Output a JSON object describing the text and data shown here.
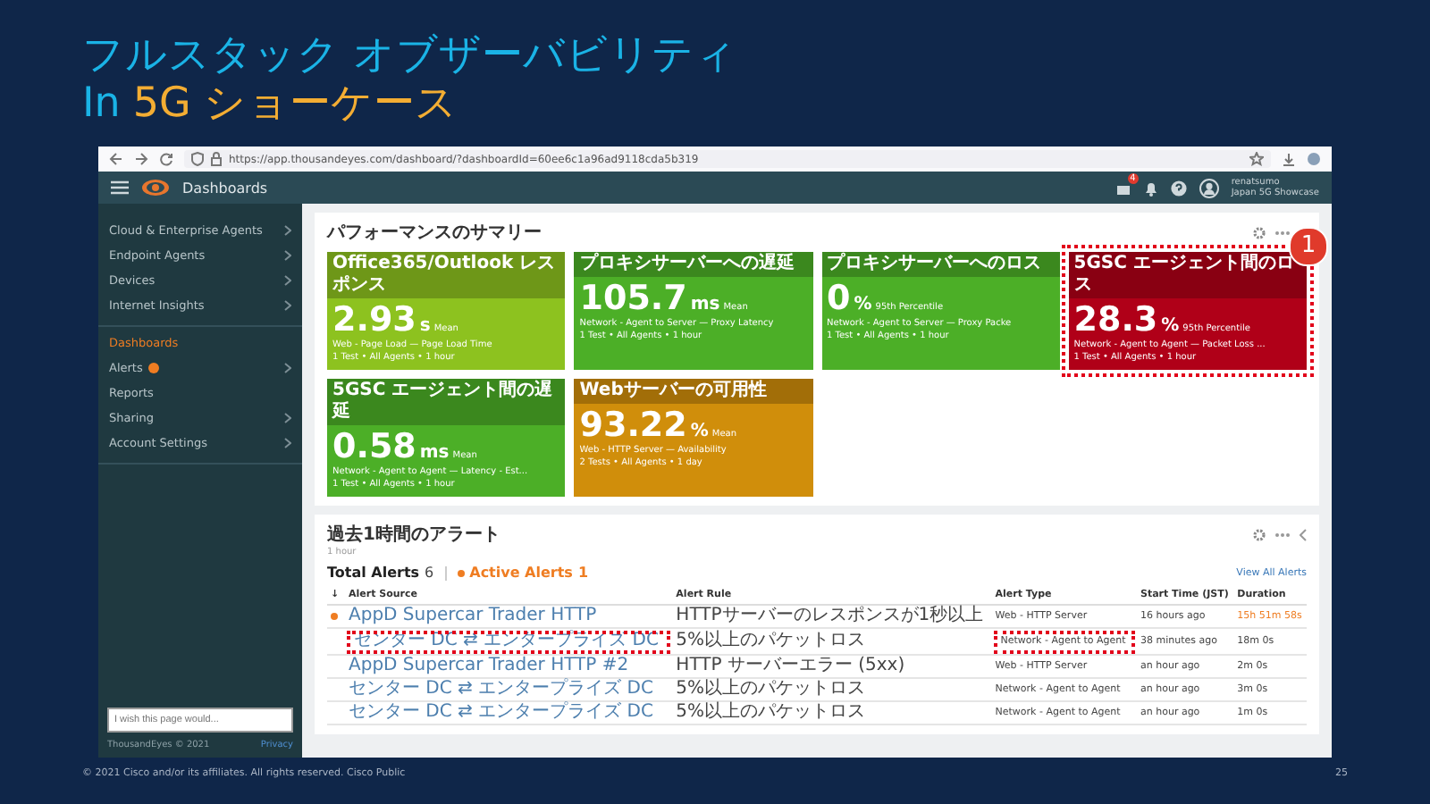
{
  "slide": {
    "title": "フルスタック オブザーバビリティ",
    "subtitle_lead": "In",
    "subtitle": "5G ショーケース"
  },
  "browser": {
    "url": "https://app.thousandeyes.com/dashboard/?dashboardId=60ee6c1a96ad9118cda5b319"
  },
  "app_header": {
    "title": "Dashboards",
    "notification_count": "4",
    "user_name": "renatsumo",
    "account": "Japan 5G Showcase"
  },
  "sidebar": {
    "sections": [
      [
        {
          "label": "Cloud & Enterprise Agents",
          "selected": false,
          "expandable": true,
          "badge": false
        },
        {
          "label": "Endpoint Agents",
          "selected": false,
          "expandable": true,
          "badge": false
        },
        {
          "label": "Devices",
          "selected": false,
          "expandable": true,
          "badge": false
        },
        {
          "label": "Internet Insights",
          "selected": false,
          "expandable": true,
          "badge": false
        }
      ],
      [
        {
          "label": "Dashboards",
          "selected": true,
          "expandable": false,
          "badge": false
        },
        {
          "label": "Alerts",
          "selected": false,
          "expandable": true,
          "badge": true
        },
        {
          "label": "Reports",
          "selected": false,
          "expandable": false,
          "badge": false
        },
        {
          "label": "Sharing",
          "selected": false,
          "expandable": true,
          "badge": false
        },
        {
          "label": "Account Settings",
          "selected": false,
          "expandable": true,
          "badge": false
        }
      ]
    ],
    "feedback_placeholder": "I wish this page would...",
    "copyright": "ThousandEyes © 2021",
    "privacy": "Privacy"
  },
  "summary_panel": {
    "title": "パフォーマンスのサマリー",
    "tiles": [
      {
        "title": "Office365/Outlook レスポンス",
        "value": "2.93",
        "unit": "s",
        "stat": "Mean",
        "metric": "Web - Page Load — Page Load Time",
        "scope": "1 Test • All Agents • 1 hour",
        "color": "#8dc21f",
        "highlighted": false
      },
      {
        "title": "プロキシサーバーへの遅延",
        "value": "105.7",
        "unit": "ms",
        "stat": "Mean",
        "metric": "Network - Agent to Server — Proxy Latency",
        "scope": "1 Test • All Agents • 1 hour",
        "color": "#4caf27",
        "highlighted": false
      },
      {
        "title": "プロキシサーバーへのロス",
        "value": "0",
        "unit": "%",
        "stat": "95th Percentile",
        "metric": "Network - Agent to Server — Proxy Packe",
        "scope": "1 Test • All Agents • 1 hour",
        "color": "#4caf27",
        "highlighted": false
      },
      {
        "title": "5GSC エージェント間のロス",
        "value": "28.3",
        "unit": "%",
        "stat": "95th Percentile",
        "metric": "Network - Agent to Agent — Packet Loss ...",
        "scope": "1 Test • All Agents • 1 hour",
        "color": "#b00018",
        "highlighted": true
      },
      {
        "title": "5GSC エージェント間の遅延",
        "value": "0.58",
        "unit": "ms",
        "stat": "Mean",
        "metric": "Network - Agent to Agent — Latency - Est...",
        "scope": "1 Test • All Agents • 1 hour",
        "color": "#4caf27",
        "highlighted": false
      },
      {
        "title": "Webサーバーの可用性",
        "value": "93.22",
        "unit": "%",
        "stat": "Mean",
        "metric": "Web - HTTP Server — Availability",
        "scope": "2 Tests • All Agents • 1 day",
        "color": "#d08e0b",
        "highlighted": false
      }
    ]
  },
  "alerts_panel": {
    "title": "過去1時間のアラート",
    "subtitle": "1 hour",
    "total_label": "Total Alerts",
    "total_count": "6",
    "active_label": "Active Alerts",
    "active_count": "1",
    "view_all": "View All Alerts",
    "sort_indicator": "↓",
    "columns": [
      "Alert Source",
      "Alert Rule",
      "Alert Type",
      "Start Time (JST)",
      "Duration"
    ],
    "rows": [
      {
        "active": true,
        "cells": [
          {
            "text": "AppD Supercar Trader HTTP",
            "highlighted": false
          },
          {
            "text": "HTTPサーバーのレスポンスが1秒以上",
            "highlighted": false
          },
          {
            "text": "Web - HTTP Server",
            "highlighted": false
          },
          {
            "text": "16 hours ago",
            "highlighted": false
          },
          {
            "text": "15h 51m 58s",
            "highlighted": false
          }
        ]
      },
      {
        "active": false,
        "cells": [
          {
            "text": "センター DC ⇄ エンタープライズ DC",
            "highlighted": true
          },
          {
            "text": "5%以上のパケットロス",
            "highlighted": false
          },
          {
            "text": "Network - Agent to Agent",
            "highlighted": true
          },
          {
            "text": "38 minutes ago",
            "highlighted": false
          },
          {
            "text": "18m 0s",
            "highlighted": false
          }
        ]
      },
      {
        "active": false,
        "cells": [
          {
            "text": "AppD Supercar Trader HTTP #2",
            "highlighted": false
          },
          {
            "text": "HTTP サーバーエラー (5xx)",
            "highlighted": false
          },
          {
            "text": "Web - HTTP Server",
            "highlighted": false
          },
          {
            "text": "an hour ago",
            "highlighted": false
          },
          {
            "text": "2m 0s",
            "highlighted": false
          }
        ]
      },
      {
        "active": false,
        "cells": [
          {
            "text": "センター DC ⇄ エンタープライズ DC",
            "highlighted": false
          },
          {
            "text": "5%以上のパケットロス",
            "highlighted": false
          },
          {
            "text": "Network - Agent to Agent",
            "highlighted": false
          },
          {
            "text": "an hour ago",
            "highlighted": false
          },
          {
            "text": "3m 0s",
            "highlighted": false
          }
        ]
      },
      {
        "active": false,
        "cells": [
          {
            "text": "センター DC ⇄ エンタープライズ DC",
            "highlighted": false
          },
          {
            "text": "5%以上のパケットロス",
            "highlighted": false
          },
          {
            "text": "Network - Agent to Agent",
            "highlighted": false
          },
          {
            "text": "an hour ago",
            "highlighted": false
          },
          {
            "text": "1m 0s",
            "highlighted": false
          }
        ]
      }
    ]
  },
  "callout": "1",
  "footer": {
    "copyright": "© 2021  Cisco and/or its affiliates. All rights reserved.   Cisco Public",
    "page": "25"
  }
}
